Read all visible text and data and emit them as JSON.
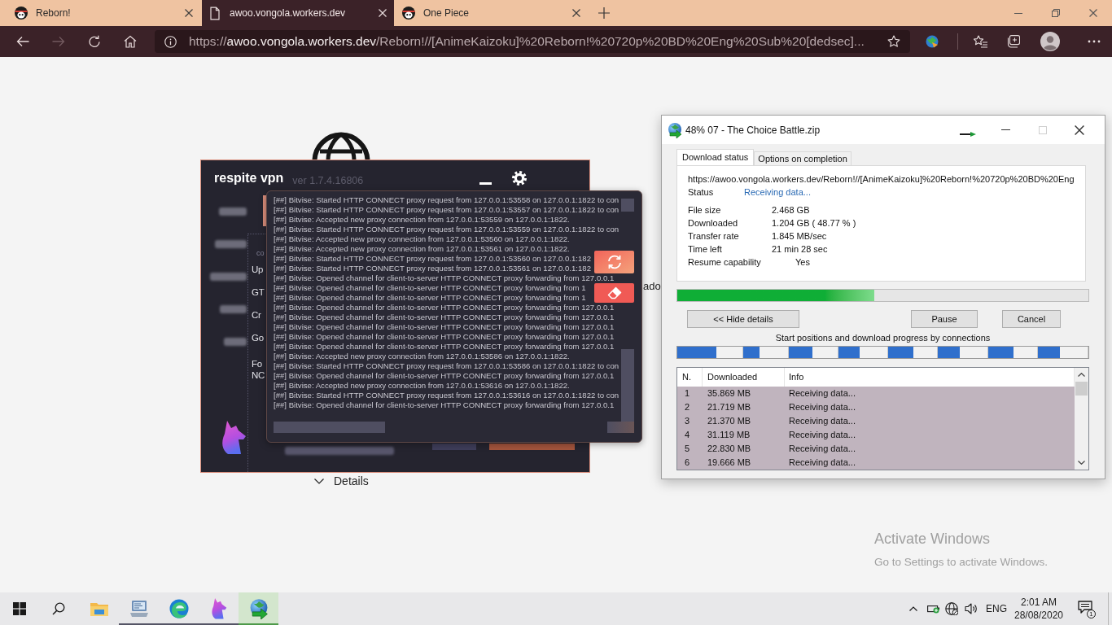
{
  "browser": {
    "tabs": [
      {
        "kind": "site",
        "title": "Reborn!",
        "selected": false
      },
      {
        "kind": "page",
        "title": "awoo.vongola.workers.dev",
        "selected": true
      },
      {
        "kind": "site",
        "title": "One Piece",
        "selected": false
      }
    ],
    "nav_buttons": [
      {
        "kind": "back",
        "disabled": false
      },
      {
        "kind": "forward",
        "disabled": true
      },
      {
        "kind": "refresh",
        "disabled": false
      },
      {
        "kind": "home",
        "disabled": false
      }
    ],
    "address": {
      "scheme": "https://",
      "host": "awoo.vongola.workers.dev",
      "path": "/Reborn!//[AnimeKaizoku]%20Reborn!%20720p%20BD%20Eng%20Sub%20[dedsec]..."
    }
  },
  "page": {
    "cut_text": "ado",
    "details_toggle": "Details"
  },
  "vpn_window": {
    "title": "respite vpn",
    "version": "ver 1.7.4.16806",
    "panel_heading": "co",
    "panel_items": [
      "Up",
      "GT",
      "Cr",
      "Go"
    ],
    "panel_note": [
      "Fo",
      "NC"
    ]
  },
  "log_window": {
    "lines": [
      "[##] Bitvise: Started HTTP CONNECT proxy request from 127.0.0.1:53558 on 127.0.0.1:1822 to con",
      "[##] Bitvise: Started HTTP CONNECT proxy request from 127.0.0.1:53557 on 127.0.0.1:1822 to con",
      "[##] Bitvise: Accepted new proxy connection from 127.0.0.1:53559 on 127.0.0.1:1822.",
      "[##] Bitvise: Started HTTP CONNECT proxy request from 127.0.0.1:53559 on 127.0.0.1:1822 to con",
      "[##] Bitvise: Accepted new proxy connection from 127.0.0.1:53560 on 127.0.0.1:1822.",
      "[##] Bitvise: Accepted new proxy connection from 127.0.0.1:53561 on 127.0.0.1:1822.",
      "[##] Bitvise: Started HTTP CONNECT proxy request from 127.0.0.1:53560 on 127.0.0.1:182",
      "[##] Bitvise: Started HTTP CONNECT proxy request from 127.0.0.1:53561 on 127.0.0.1:182",
      "[##] Bitvise: Opened channel for client-to-server HTTP CONNECT proxy forwarding from 127.0.0.1",
      "[##] Bitvise: Opened channel for client-to-server HTTP CONNECT proxy forwarding from 1",
      "[##] Bitvise: Opened channel for client-to-server HTTP CONNECT proxy forwarding from 1",
      "[##] Bitvise: Opened channel for client-to-server HTTP CONNECT proxy forwarding from 127.0.0.1",
      "[##] Bitvise: Opened channel for client-to-server HTTP CONNECT proxy forwarding from 127.0.0.1",
      "[##] Bitvise: Opened channel for client-to-server HTTP CONNECT proxy forwarding from 127.0.0.1",
      "[##] Bitvise: Opened channel for client-to-server HTTP CONNECT proxy forwarding from 127.0.0.1",
      "[##] Bitvise: Opened channel for client-to-server HTTP CONNECT proxy forwarding from 127.0.0.1",
      "[##] Bitvise: Accepted new proxy connection from 127.0.0.1:53586 on 127.0.0.1:1822.",
      "[##] Bitvise: Started HTTP CONNECT proxy request from 127.0.0.1:53586 on 127.0.0.1:1822 to con",
      "[##] Bitvise: Opened channel for client-to-server HTTP CONNECT proxy forwarding from 127.0.0.1",
      "[##] Bitvise: Accepted new proxy connection from 127.0.0.1:53616 on 127.0.0.1:1822.",
      "[##] Bitvise: Started HTTP CONNECT proxy request from 127.0.0.1:53616 on 127.0.0.1:1822 to con",
      "[##] Bitvise: Opened channel for client-to-server HTTP CONNECT proxy forwarding from 127.0.0.1"
    ]
  },
  "download_window": {
    "title": "48% 07 - The Choice Battle.zip",
    "tabs": [
      {
        "label": "Download status",
        "selected": true
      },
      {
        "label": "Options on completion",
        "selected": false
      }
    ],
    "url": "https://awoo.vongola.workers.dev/Reborn!//[AnimeKaizoku]%20Reborn!%20720p%20BD%20Eng",
    "status": {
      "label": "Status",
      "value": "Receiving data..."
    },
    "details": [
      {
        "kind": "metric",
        "label": "File size",
        "value": "2.468 GB"
      },
      {
        "kind": "metric",
        "label": "Downloaded",
        "value": "1.204 GB ( 48.77 % )"
      },
      {
        "kind": "metric",
        "label": "Transfer rate",
        "value": "1.845 MB/sec"
      },
      {
        "kind": "metric",
        "label": "Time left",
        "value": "21 min 28 sec"
      },
      {
        "kind": "flag",
        "label": "Resume capability",
        "value": "Yes"
      }
    ],
    "progress": {
      "level": 0.48
    },
    "buttons": [
      "<< Hide details",
      "Pause",
      "Cancel"
    ],
    "connections_label": "Start positions and download progress by connections",
    "connections_bar": [
      {
        "level": 0.6
      },
      {
        "level": 0.36
      },
      {
        "level": 0.49
      },
      {
        "level": 0.44
      },
      {
        "level": 0.52
      },
      {
        "level": 0.44
      },
      {
        "level": 0.51
      },
      {
        "level": 0.44
      }
    ],
    "table": {
      "columns": [
        "N.",
        "Downloaded",
        "Info"
      ],
      "rows": [
        [
          "1",
          "35.869 MB",
          "Receiving data..."
        ],
        [
          "2",
          "21.719 MB",
          "Receiving data..."
        ],
        [
          "3",
          "21.370 MB",
          "Receiving data..."
        ],
        [
          "4",
          "31.119 MB",
          "Receiving data..."
        ],
        [
          "5",
          "22.830 MB",
          "Receiving data..."
        ],
        [
          "6",
          "19.666 MB",
          "Receiving data..."
        ]
      ]
    }
  },
  "taskbar": {
    "apps": [
      {
        "kind": "files",
        "running": false,
        "selected": false
      },
      {
        "kind": "terminal",
        "running": true,
        "selected": false
      },
      {
        "kind": "browser",
        "running": true,
        "selected": false
      },
      {
        "kind": "wolf",
        "running": true,
        "selected": false
      },
      {
        "kind": "downloader",
        "running": true,
        "selected": true
      }
    ],
    "tray": {
      "language": "ENG",
      "time": "2:01 AM",
      "date": "28/08/2020",
      "notifications": "1"
    }
  },
  "activation_notice": {
    "title": "Activate Windows",
    "text": "Go to Settings to activate Windows."
  }
}
